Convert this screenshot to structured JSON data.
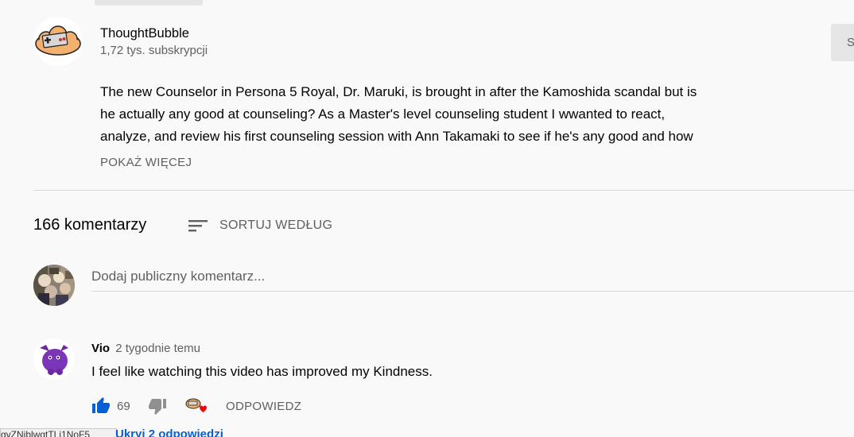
{
  "channel": {
    "name": "ThoughtBubble",
    "subscribers": "1,72 tys. subskrypcji",
    "subscribe_label": "S"
  },
  "description": {
    "lines": [
      "The new Counselor in Persona 5 Royal, Dr. Maruki, is brought in after the Kamoshida scandal but is",
      "he actually any good at counseling? As a Master's level counseling student I wwanted to react,",
      "analyze, and review his first counseling session with Ann Takamaki to see if he's any good and how"
    ],
    "show_more": "POKAŻ WIĘCEJ"
  },
  "comments_section": {
    "count_label": "166 komentarzy",
    "sort_label": "SORTUJ WEDŁUG",
    "input_placeholder": "Dodaj publiczny komentarz..."
  },
  "comment": {
    "author": "Vio",
    "time": "2 tygodnie temu",
    "text": "I feel like watching this video has improved my Kindness.",
    "likes": "69",
    "reply_label": "ODPOWIEDZ",
    "hide_replies": "Ukryj 2 odpowiedzi"
  },
  "status_bar": {
    "url_fragment": "gyZNjblwgtTLi1NoF5"
  },
  "icons": {
    "sort": "sort-icon",
    "like": "thumbs-up-icon",
    "dislike": "thumbs-down-icon",
    "heart": "creator-heart-icon"
  },
  "colors": {
    "background": "#f9f9f9",
    "text_primary": "#030303",
    "text_secondary": "#606060",
    "link_blue": "#065fd4",
    "like_blue": "#065fd4",
    "heart_red": "#ff0000"
  }
}
